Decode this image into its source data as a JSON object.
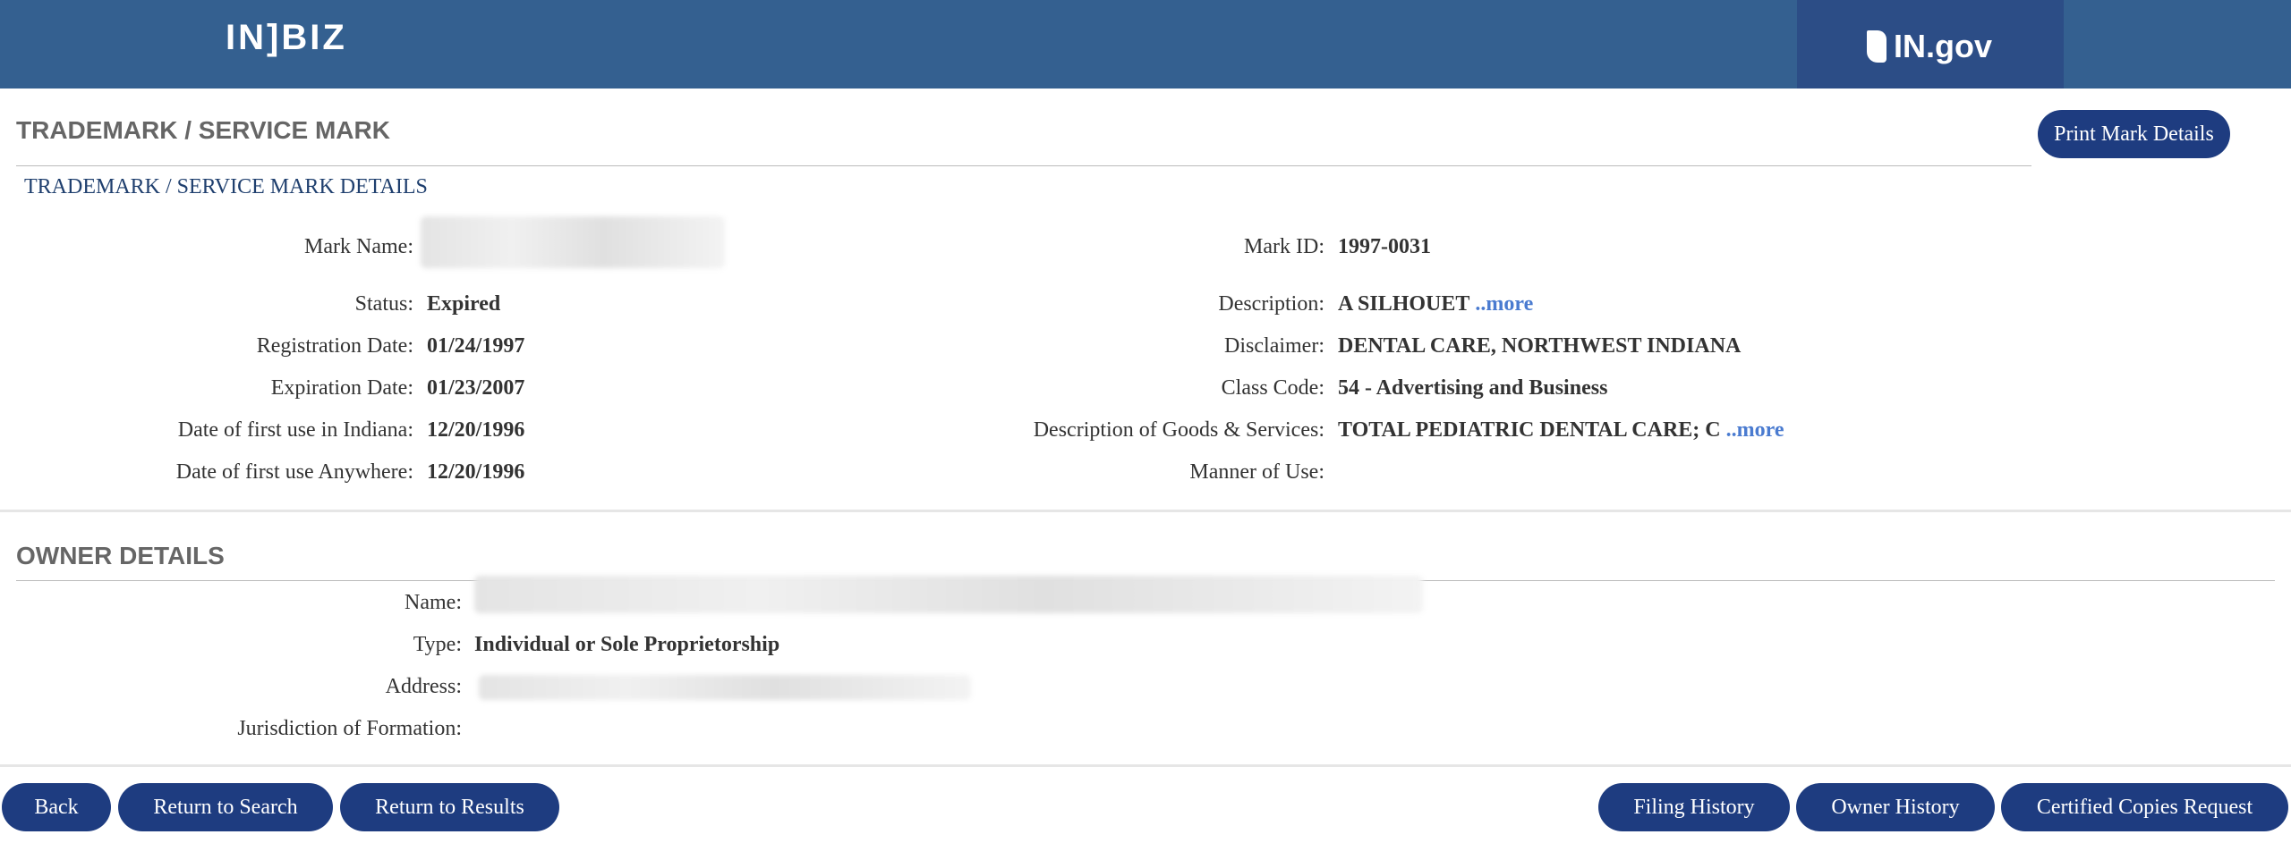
{
  "header": {
    "logo_text": "IN]BIZ",
    "gov_logo_text": "IN.gov"
  },
  "trademark": {
    "section_title": "TRADEMARK / SERVICE MARK",
    "print_button": "Print Mark Details",
    "details_title": "TRADEMARK / SERVICE MARK DETAILS",
    "left_fields": [
      {
        "label": "Mark Name:",
        "value": ""
      },
      {
        "label": "Status:",
        "value": "Expired"
      },
      {
        "label": "Registration Date:",
        "value": "01/24/1997"
      },
      {
        "label": "Expiration Date:",
        "value": "01/23/2007"
      },
      {
        "label": "Date of first use in Indiana:",
        "value": "12/20/1996"
      },
      {
        "label": "Date of first use Anywhere:",
        "value": "12/20/1996"
      }
    ],
    "right_fields": [
      {
        "label": "Mark ID:",
        "value": "1997-0031"
      },
      {
        "label": "Description:",
        "value": "A SILHOUET",
        "more": "..more"
      },
      {
        "label": "Disclaimer:",
        "value": "DENTAL CARE, NORTHWEST INDIANA"
      },
      {
        "label": "Class Code:",
        "value": "54 - Advertising and Business"
      },
      {
        "label": "Description of Goods & Services:",
        "value": "TOTAL PEDIATRIC DENTAL CARE; C",
        "more": "..more"
      },
      {
        "label": "Manner of Use:",
        "value": ""
      }
    ]
  },
  "owner": {
    "section_title": "OWNER DETAILS",
    "fields": [
      {
        "label": "Name:",
        "value": ""
      },
      {
        "label": "Type:",
        "value": "Individual or Sole Proprietorship"
      },
      {
        "label": "Address:",
        "value": ""
      },
      {
        "label": "Jurisdiction of Formation:",
        "value": ""
      }
    ]
  },
  "footer_buttons": {
    "back": "Back",
    "return_search": "Return to Search",
    "return_results": "Return to Results",
    "filing_history": "Filing History",
    "owner_history": "Owner History",
    "certified_copies": "Certified Copies Request"
  },
  "colors": {
    "header_bg": "#346090",
    "gov_box_bg": "#2c4d86",
    "button_bg": "#1e3c80",
    "link": "#4a7bd0",
    "accent": "#e2a23b"
  }
}
